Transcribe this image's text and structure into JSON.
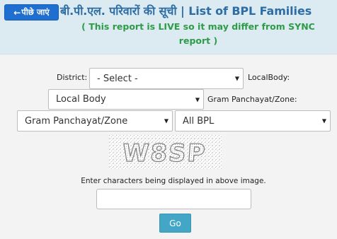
{
  "header": {
    "back_label": "पीछे जाएं",
    "title": "बी.पी.एल. परिवारों की सूची | List of BPL Families",
    "live_note": "( This report is LIVE so it may differ from SYNC report )"
  },
  "form": {
    "district_label": "District:",
    "district_value": "- Select -",
    "localbody_label": "LocalBody:",
    "localbody_value": "Local Body",
    "panchayat_label": "Gram Panchayat/Zone:",
    "panchayat_value": "Gram Panchayat/Zone",
    "bpl_value": "All BPL"
  },
  "captcha": {
    "text": "W8SP",
    "hint": "Enter characters being displayed in above image.",
    "input_value": ""
  },
  "go_label": "Go",
  "colors": {
    "header_bg": "#dcebf1",
    "title": "#2e6da4",
    "live_note": "#2e9b48",
    "back_button": "#1f6fd1",
    "go_button": "#43a6c6"
  }
}
